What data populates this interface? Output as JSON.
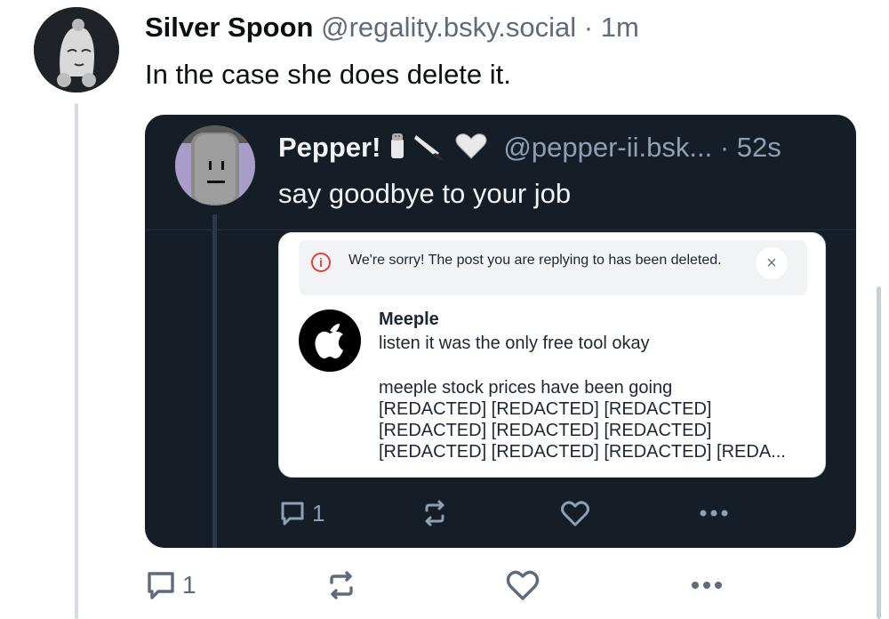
{
  "outer_post": {
    "display_name": "Silver Spoon",
    "handle": "@regality.bsky.social",
    "separator": " · ",
    "time": "1m",
    "text": "In the case she does delete it.",
    "reply_count": "1"
  },
  "quoted_screenshot": {
    "display_name": "Pepper!",
    "handle": "@pepper-ii.bsk...",
    "separator": " · ",
    "time": "52s",
    "text": "say goodbye to your job",
    "reply_count": "1",
    "name_emojis": [
      "salt-shaker-icon",
      "knife-icon",
      "white-heart-icon"
    ]
  },
  "deleted_notice": {
    "message": "We're sorry! The post you are replying to has been deleted.",
    "close_symbol": "×",
    "info_symbol": "i"
  },
  "reply_target": {
    "display_name": "Meeple",
    "lines": [
      "listen it was the only free tool okay",
      "",
      "meeple stock prices have been going",
      "[REDACTED] [REDACTED] [REDACTED]",
      "[REDACTED] [REDACTED] [REDACTED]",
      "[REDACTED] [REDACTED] [REDACTED] [REDA..."
    ]
  },
  "colors": {
    "card_bg": "#151d27",
    "accent_dark_icon": "#8ea0b3",
    "accent_light_icon": "#5d6b7a",
    "error_red": "#e0423a"
  }
}
